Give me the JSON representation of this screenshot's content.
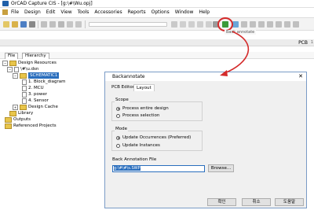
{
  "window": {
    "title": "OrCAD Capture CIS - [g:\\#\\Wu.opj]"
  },
  "menu": [
    "File",
    "Design",
    "Edit",
    "View",
    "Tools",
    "Accessories",
    "Reports",
    "Options",
    "Window",
    "Help"
  ],
  "toolbar": {
    "tooltip": "Back annotate"
  },
  "subbar": {
    "pcb_label": "PCB",
    "number": "1"
  },
  "project_tabs": {
    "file": "File",
    "hierarchy": "Hierarchy"
  },
  "tree": {
    "design_resources": "Design Resources",
    "dsn": "\\#\\u.dsn",
    "schematic": "SCHEMATIC1",
    "pages": [
      "1. Block_diagram",
      "2. MCU",
      "3. power",
      "4. Sensor"
    ],
    "design_cache": "Design Cache",
    "library": "Library",
    "outputs": "Outputs",
    "referenced_projects": "Referenced Projects"
  },
  "dialog": {
    "title": "Backannotate",
    "tabs": [
      "PCB Editor",
      "Layout"
    ],
    "scope": {
      "label": "Scope",
      "options": [
        "Process entire design",
        "Process selection"
      ]
    },
    "mode": {
      "label": "Mode",
      "options": [
        "Update Occurrences (Preferred)",
        "Update Instances"
      ]
    },
    "file_label": "Back Annotation File",
    "file_value": "g:\\#\\#\\s.SWP",
    "browse": "Browse...",
    "ok": "확인",
    "cancel": "취소",
    "help": "도움말"
  },
  "colors": {
    "highlight": "#d42a2a",
    "selection": "#2a6ebd",
    "folder": "#e8c54a"
  }
}
